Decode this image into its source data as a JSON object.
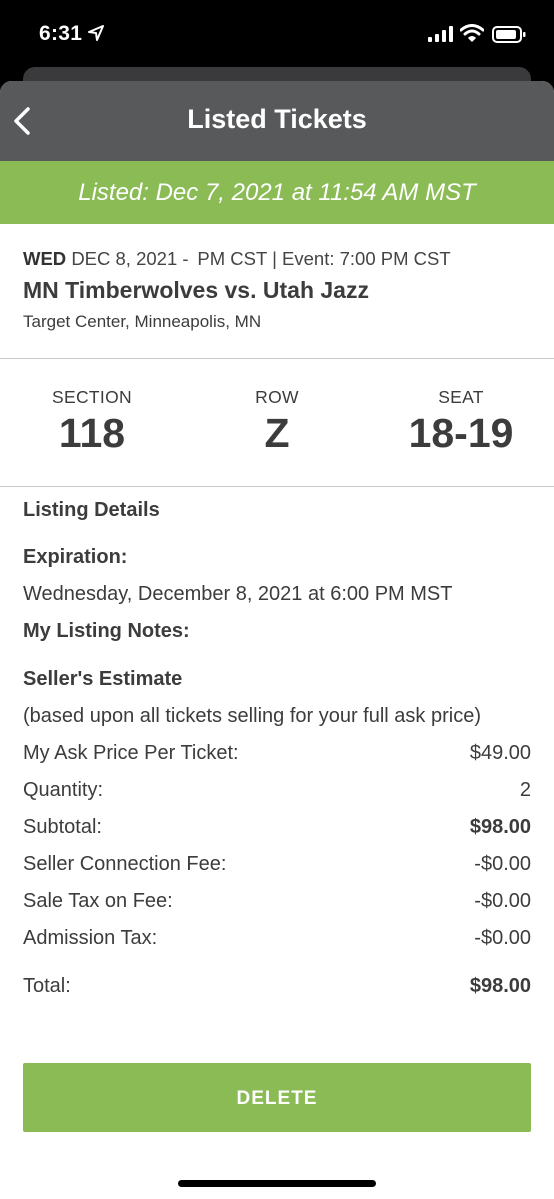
{
  "status": {
    "time": "6:31"
  },
  "nav": {
    "title": "Listed Tickets"
  },
  "banner": {
    "text": "Listed: Dec 7, 2021 at 11:54 AM MST"
  },
  "event": {
    "day": "WED",
    "date_line": "DEC 8, 2021 -  PM CST | Event: 7:00 PM CST",
    "title": "MN Timberwolves vs. Utah Jazz",
    "venue": "Target Center, Minneapolis, MN"
  },
  "seating": {
    "section_label": "SECTION",
    "section": "118",
    "row_label": "ROW",
    "row": "Z",
    "seat_label": "SEAT",
    "seat": "18-19"
  },
  "details": {
    "heading": "Listing Details",
    "expiration_label": "Expiration:",
    "expiration_value": "Wednesday, December 8, 2021 at 6:00 PM MST",
    "notes_label": "My Listing Notes:",
    "estimate_heading": "Seller's Estimate",
    "estimate_note": "(based upon all tickets selling for your full ask price)",
    "rows": [
      {
        "label": "My Ask Price Per Ticket:",
        "value": "$49.00"
      },
      {
        "label": "Quantity:",
        "value": "2"
      },
      {
        "label": "Subtotal:",
        "value": "$98.00"
      },
      {
        "label": "Seller Connection Fee:",
        "value": "-$0.00"
      },
      {
        "label": "Sale Tax on Fee:",
        "value": "-$0.00"
      },
      {
        "label": "Admission Tax:",
        "value": "-$0.00"
      }
    ],
    "total_label": "Total:",
    "total_value": "$98.00"
  },
  "actions": {
    "delete_label": "DELETE"
  },
  "colors": {
    "accent_green": "#8bbb55",
    "nav_gray": "#58595b",
    "text": "#3c3c3c"
  }
}
